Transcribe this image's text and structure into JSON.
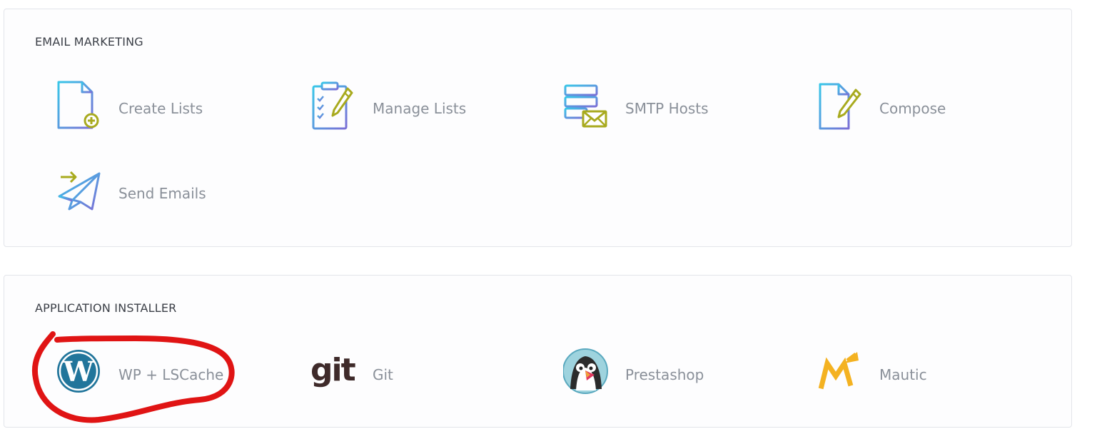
{
  "email_marketing": {
    "title": "EMAIL MARKETING",
    "items": [
      {
        "label": "Create Lists",
        "icon": "create-list-icon"
      },
      {
        "label": "Manage Lists",
        "icon": "clipboard-checklist-icon"
      },
      {
        "label": "SMTP Hosts",
        "icon": "server-mail-icon"
      },
      {
        "label": "Compose",
        "icon": "document-pencil-icon"
      },
      {
        "label": "Send Emails",
        "icon": "paper-plane-icon"
      }
    ]
  },
  "application_installer": {
    "title": "APPLICATION INSTALLER",
    "items": [
      {
        "label": "WP + LSCache",
        "icon": "wordpress-icon"
      },
      {
        "label": "Git",
        "icon": "git-logo-icon"
      },
      {
        "label": "Prestashop",
        "icon": "prestashop-puffin-icon"
      },
      {
        "label": "Mautic",
        "icon": "mautic-icon"
      }
    ]
  },
  "icon_art": {
    "git_word": "git"
  },
  "colors": {
    "icon_gradient_start": "#38c6e8",
    "icon_gradient_end": "#7b6fd6",
    "accent_olive": "#a8aa1e",
    "wordpress_blue": "#21759b",
    "annotation_red": "#e01414",
    "mautic_orange": "#f4b221"
  }
}
